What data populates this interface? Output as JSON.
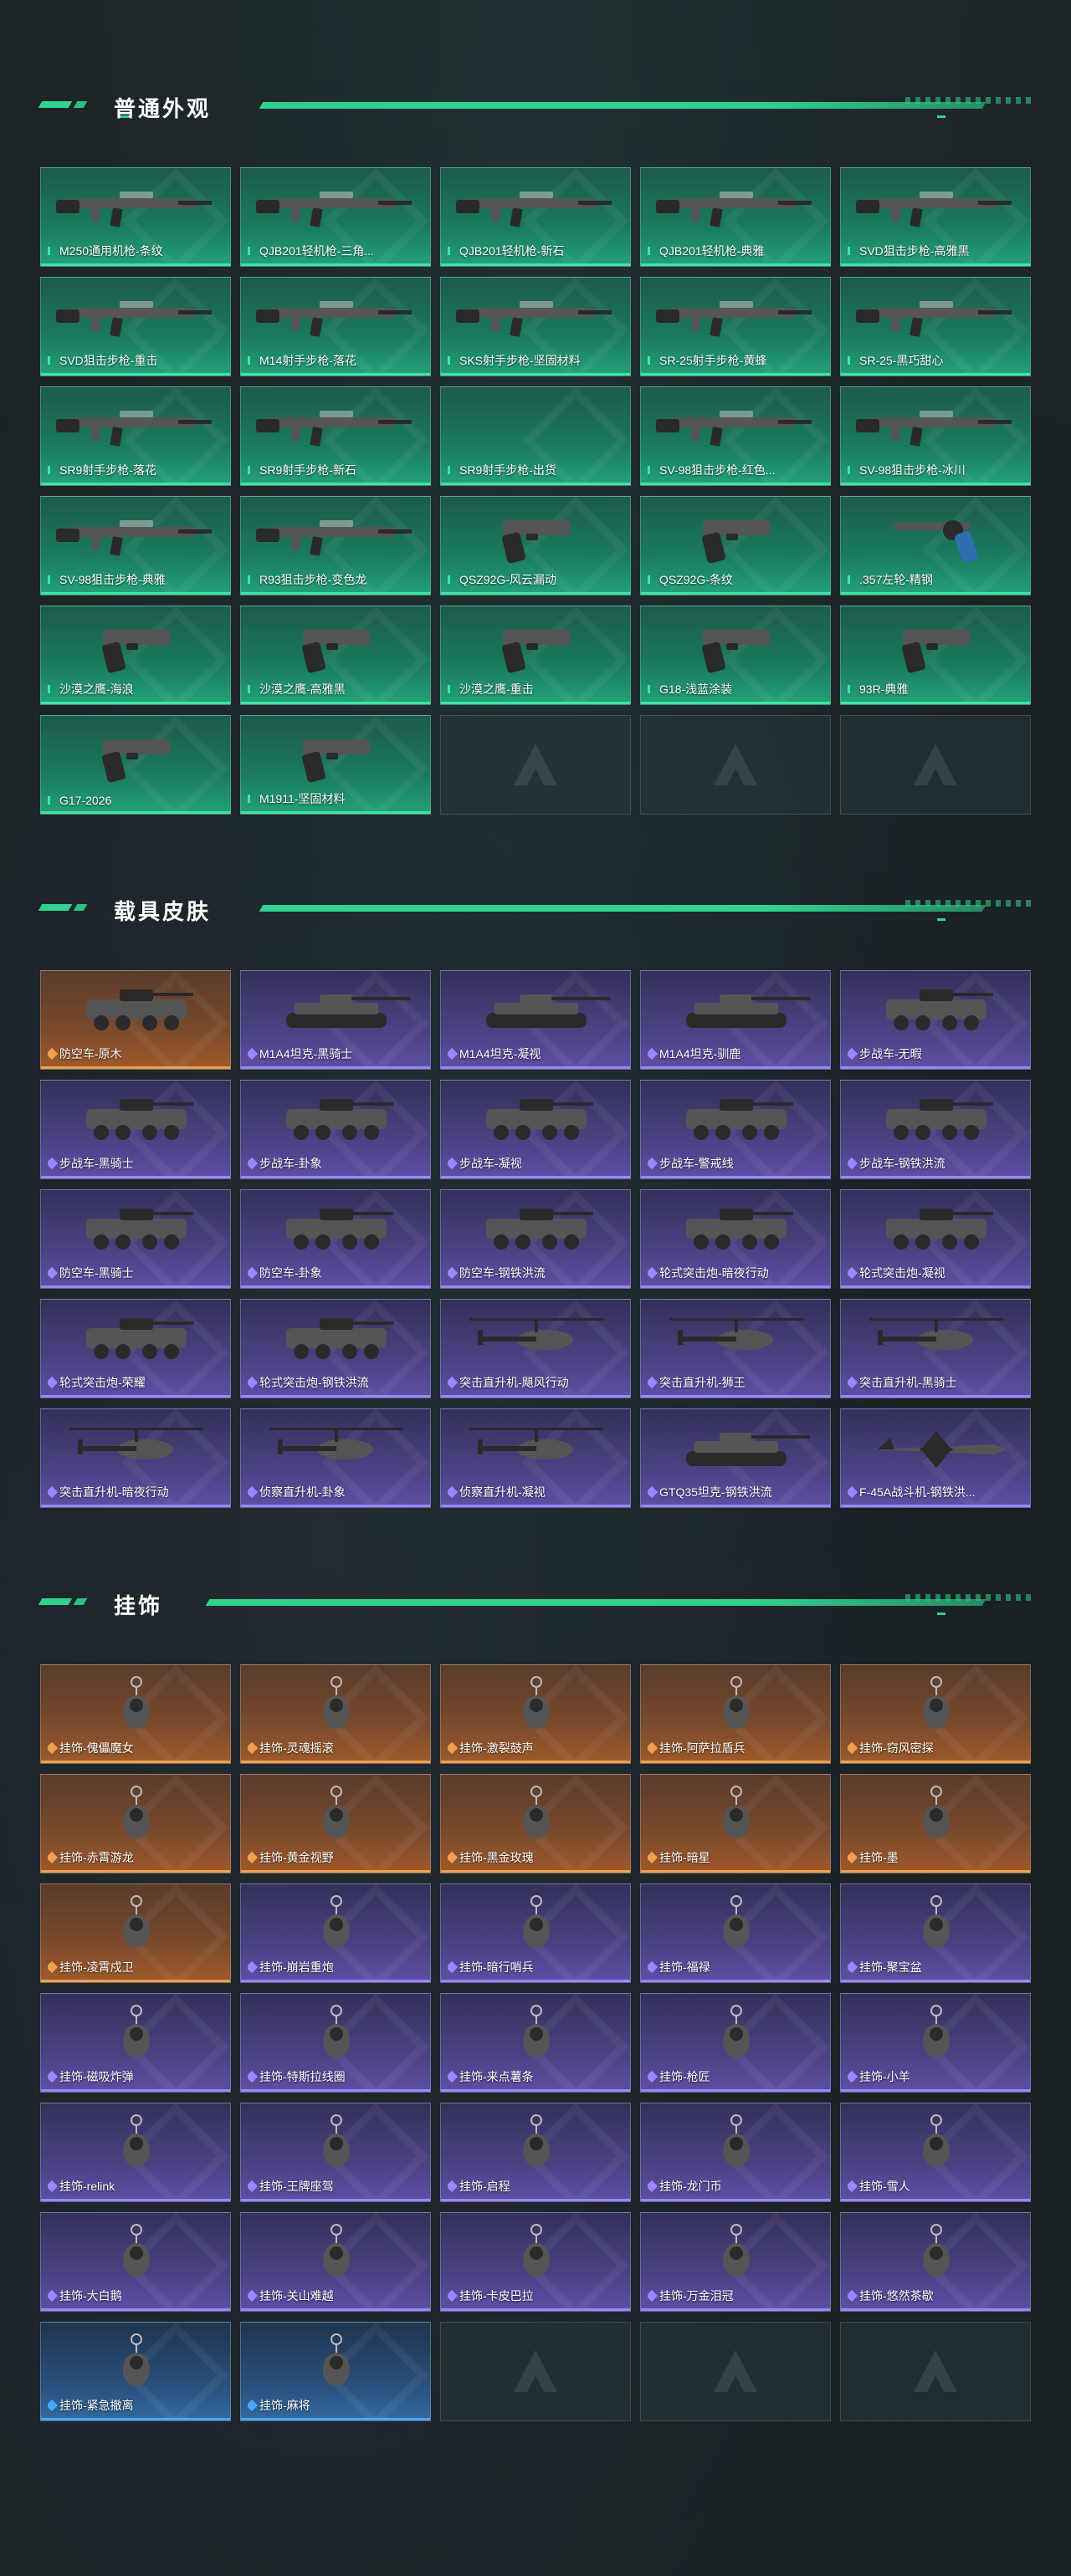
{
  "sections": [
    {
      "title": "普通外观",
      "tier": "green",
      "items": [
        {
          "label": "M250通用机枪-条纹",
          "icon": "machine-gun-icon"
        },
        {
          "label": "QJB201轻机枪-三角...",
          "icon": "light-machine-gun-icon"
        },
        {
          "label": "QJB201轻机枪-新石",
          "icon": "light-machine-gun-icon"
        },
        {
          "label": "QJB201轻机枪-典雅",
          "icon": "light-machine-gun-icon"
        },
        {
          "label": "SVD狙击步枪-高雅黑",
          "icon": "sniper-rifle-icon"
        },
        {
          "label": "SVD狙击步枪-重击",
          "icon": "sniper-rifle-icon"
        },
        {
          "label": "M14射手步枪-落花",
          "icon": "marksman-rifle-icon"
        },
        {
          "label": "SKS射手步枪-坚固材料",
          "icon": "marksman-rifle-icon"
        },
        {
          "label": "SR-25射手步枪-黄蜂",
          "icon": "marksman-rifle-icon"
        },
        {
          "label": "SR-25-黑巧甜心",
          "icon": "marksman-rifle-icon"
        },
        {
          "label": "SR9射手步枪-落花",
          "icon": "marksman-rifle-icon"
        },
        {
          "label": "SR9射手步枪-新石",
          "icon": "marksman-rifle-icon"
        },
        {
          "label": "SR9射手步枪-出货",
          "icon": ""
        },
        {
          "label": "SV-98狙击步枪-红色...",
          "icon": "sniper-rifle-icon"
        },
        {
          "label": "SV-98狙击步枪-冰川",
          "icon": "sniper-rifle-icon"
        },
        {
          "label": "SV-98狙击步枪-典雅",
          "icon": "sniper-rifle-icon"
        },
        {
          "label": "R93狙击步枪-变色龙",
          "icon": "sniper-rifle-icon"
        },
        {
          "label": "QSZ92G-风云漏动",
          "icon": "pistol-icon"
        },
        {
          "label": "QSZ92G-条纹",
          "icon": "pistol-icon"
        },
        {
          "label": ".357左轮-精钢",
          "icon": "revolver-icon"
        },
        {
          "label": "沙漠之鹰-海浪",
          "icon": "pistol-icon"
        },
        {
          "label": "沙漠之鹰-高雅黑",
          "icon": "pistol-icon"
        },
        {
          "label": "沙漠之鹰-重击",
          "icon": "pistol-icon"
        },
        {
          "label": "G18-浅蓝涂装",
          "icon": "pistol-icon"
        },
        {
          "label": "93R-典雅",
          "icon": "pistol-icon"
        },
        {
          "label": "G17-2026",
          "icon": "pistol-icon"
        },
        {
          "label": "M1911-坚固材料",
          "icon": "pistol-icon"
        }
      ],
      "empty_slots": 3
    },
    {
      "title": "载具皮肤",
      "items": [
        {
          "label": "防空车-原木",
          "tier": "orange",
          "icon": "armored-vehicle-icon"
        },
        {
          "label": "M1A4坦克-黑骑士",
          "tier": "purple",
          "icon": "tank-icon"
        },
        {
          "label": "M1A4坦克-凝视",
          "tier": "purple",
          "icon": "tank-icon"
        },
        {
          "label": "M1A4坦克-驯鹿",
          "tier": "purple",
          "icon": "tank-icon"
        },
        {
          "label": "步战车-无暇",
          "tier": "purple",
          "icon": "armored-vehicle-icon"
        },
        {
          "label": "步战车-黑骑士",
          "tier": "purple",
          "icon": "armored-vehicle-icon"
        },
        {
          "label": "步战车-卦象",
          "tier": "purple",
          "icon": "armored-vehicle-icon"
        },
        {
          "label": "步战车-凝视",
          "tier": "purple",
          "icon": "armored-vehicle-icon"
        },
        {
          "label": "步战车-警戒线",
          "tier": "purple",
          "icon": "armored-vehicle-icon"
        },
        {
          "label": "步战车-钢铁洪流",
          "tier": "purple",
          "icon": "armored-vehicle-icon"
        },
        {
          "label": "防空车-黑骑士",
          "tier": "purple",
          "icon": "armored-vehicle-icon"
        },
        {
          "label": "防空车-卦象",
          "tier": "purple",
          "icon": "armored-vehicle-icon"
        },
        {
          "label": "防空车-钢铁洪流",
          "tier": "purple",
          "icon": "armored-vehicle-icon"
        },
        {
          "label": "轮式突击炮-暗夜行动",
          "tier": "purple",
          "icon": "armored-vehicle-icon"
        },
        {
          "label": "轮式突击炮-凝视",
          "tier": "purple",
          "icon": "armored-vehicle-icon"
        },
        {
          "label": "轮式突击炮-荣耀",
          "tier": "purple",
          "icon": "armored-vehicle-icon"
        },
        {
          "label": "轮式突击炮-钢铁洪流",
          "tier": "purple",
          "icon": "armored-vehicle-icon"
        },
        {
          "label": "突击直升机-飓风行动",
          "tier": "purple",
          "icon": "helicopter-icon"
        },
        {
          "label": "突击直升机-狮王",
          "tier": "purple",
          "icon": "helicopter-icon"
        },
        {
          "label": "突击直升机-黑骑士",
          "tier": "purple",
          "icon": "helicopter-icon"
        },
        {
          "label": "突击直升机-暗夜行动",
          "tier": "purple",
          "icon": "helicopter-icon"
        },
        {
          "label": "侦察直升机-卦象",
          "tier": "purple",
          "icon": "helicopter-icon"
        },
        {
          "label": "侦察直升机-凝视",
          "tier": "purple",
          "icon": "helicopter-icon"
        },
        {
          "label": "GTQ35坦克-钢铁洪流",
          "tier": "purple",
          "icon": "tank-icon"
        },
        {
          "label": "F-45A战斗机-钢铁洪...",
          "tier": "purple",
          "icon": "fighter-jet-icon"
        }
      ],
      "empty_slots": 0
    },
    {
      "title": "挂饰",
      "items": [
        {
          "label": "挂饰-傀儡魔女",
          "tier": "orange",
          "icon": "charm-icon"
        },
        {
          "label": "挂饰-灵魂摇滚",
          "tier": "orange",
          "icon": "charm-icon"
        },
        {
          "label": "挂饰-激裂鼓声",
          "tier": "orange",
          "icon": "charm-icon"
        },
        {
          "label": "挂饰-阿萨拉盾兵",
          "tier": "orange",
          "icon": "charm-icon"
        },
        {
          "label": "挂饰-窃风密探",
          "tier": "orange",
          "icon": "charm-icon"
        },
        {
          "label": "挂饰-赤霄游龙",
          "tier": "orange",
          "icon": "charm-icon"
        },
        {
          "label": "挂饰-黄金视野",
          "tier": "orange",
          "icon": "charm-icon"
        },
        {
          "label": "挂饰-黑金玫瑰",
          "tier": "orange",
          "icon": "charm-icon"
        },
        {
          "label": "挂饰-暗星",
          "tier": "orange",
          "icon": "charm-icon"
        },
        {
          "label": "挂饰-墨",
          "tier": "orange",
          "icon": "charm-icon"
        },
        {
          "label": "挂饰-凌霄戍卫",
          "tier": "orange",
          "icon": "charm-icon"
        },
        {
          "label": "挂饰-崩岩重炮",
          "tier": "purple",
          "icon": "charm-icon"
        },
        {
          "label": "挂饰-暗行哨兵",
          "tier": "purple",
          "icon": "charm-icon"
        },
        {
          "label": "挂饰-福禄",
          "tier": "purple",
          "icon": "charm-icon"
        },
        {
          "label": "挂饰-聚宝盆",
          "tier": "purple",
          "icon": "charm-icon"
        },
        {
          "label": "挂饰-磁吸炸弹",
          "tier": "purple",
          "icon": "charm-icon"
        },
        {
          "label": "挂饰-特斯拉线圈",
          "tier": "purple",
          "icon": "charm-icon"
        },
        {
          "label": "挂饰-来点薯条",
          "tier": "purple",
          "icon": "charm-icon"
        },
        {
          "label": "挂饰-枪匠",
          "tier": "purple",
          "icon": "charm-icon"
        },
        {
          "label": "挂饰-小羊",
          "tier": "purple",
          "icon": "charm-icon"
        },
        {
          "label": "挂饰-relink",
          "tier": "purple",
          "icon": "charm-icon"
        },
        {
          "label": "挂饰-王牌座驾",
          "tier": "purple",
          "icon": "charm-icon"
        },
        {
          "label": "挂饰-启程",
          "tier": "purple",
          "icon": "charm-icon"
        },
        {
          "label": "挂饰-龙门币",
          "tier": "purple",
          "icon": "charm-icon"
        },
        {
          "label": "挂饰-雪人",
          "tier": "purple",
          "icon": "charm-icon"
        },
        {
          "label": "挂饰-大白鹅",
          "tier": "purple",
          "icon": "charm-icon"
        },
        {
          "label": "挂饰-关山难越",
          "tier": "purple",
          "icon": "charm-icon"
        },
        {
          "label": "挂饰-卡皮巴拉",
          "tier": "purple",
          "icon": "charm-icon"
        },
        {
          "label": "挂饰-万金泪冠",
          "tier": "purple",
          "icon": "charm-icon"
        },
        {
          "label": "挂饰-悠然茶歇",
          "tier": "purple",
          "icon": "charm-icon"
        },
        {
          "label": "挂饰-紧急撤离",
          "tier": "blue",
          "icon": "charm-icon"
        },
        {
          "label": "挂饰-麻将",
          "tier": "blue",
          "icon": "charm-icon"
        }
      ],
      "empty_slots": 3
    }
  ],
  "colors": {
    "accent": "#2fd38e",
    "green_tier": "#3ee6a4",
    "orange_tier": "#f0a050",
    "purple_tier": "#9d86ff",
    "blue_tier": "#4aa8ff"
  }
}
